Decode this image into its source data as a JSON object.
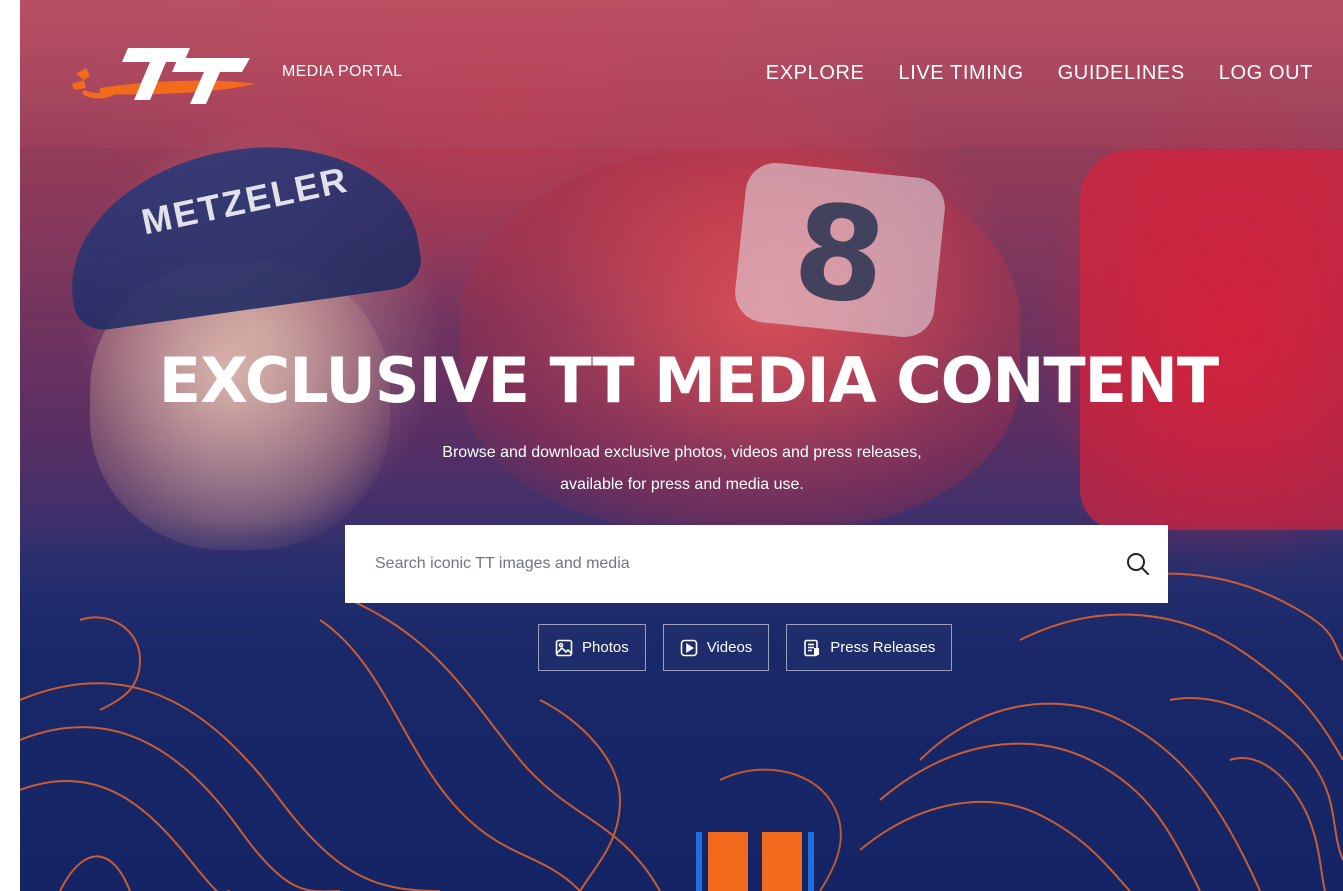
{
  "header": {
    "logo_text": "TT",
    "portal_label": "MEDIA PORTAL",
    "nav": [
      {
        "label": "EXPLORE"
      },
      {
        "label": "LIVE TIMING"
      },
      {
        "label": "GUIDELINES"
      },
      {
        "label": "LOG OUT"
      }
    ]
  },
  "hero": {
    "headline": "EXCLUSIVE TT MEDIA CONTENT",
    "subtitle_line1": "Browse and download exclusive photos, videos and press releases,",
    "subtitle_line2": "available for press and media use.",
    "background_number": "8",
    "cap_text": "METZELER"
  },
  "search": {
    "placeholder": "Search iconic TT images and media",
    "value": "",
    "icon": "search-icon"
  },
  "filters": [
    {
      "label": "Photos",
      "icon": "image-icon"
    },
    {
      "label": "Videos",
      "icon": "play-icon"
    },
    {
      "label": "Press Releases",
      "icon": "document-icon"
    }
  ],
  "colors": {
    "brand_orange": "#f26a1b",
    "brand_navy": "#172766",
    "accent_blue": "#1f6fe0",
    "white": "#ffffff"
  }
}
